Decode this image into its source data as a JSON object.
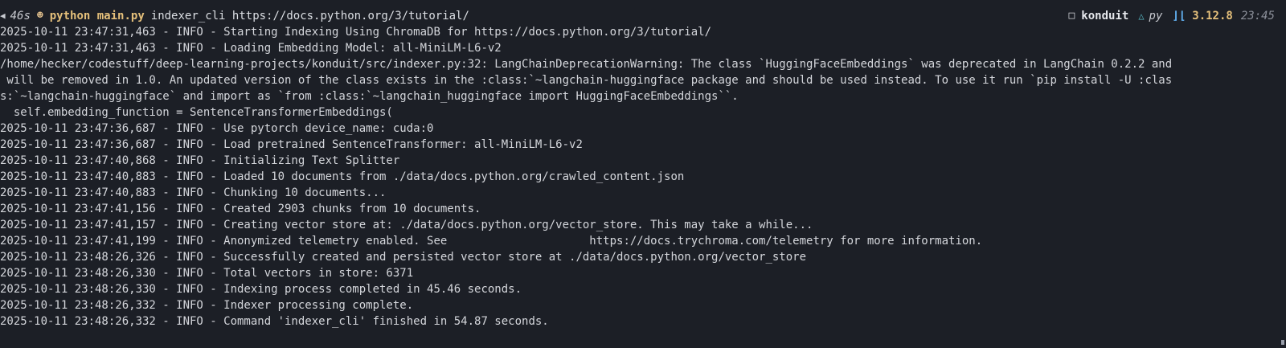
{
  "prompt": {
    "duration": "46s",
    "command_exe": "python main.py",
    "command_args": "indexer_cli https://docs.python.org/3/tutorial/",
    "directory": "konduit",
    "language": "py",
    "python_version": "3.12.8",
    "clock": "23:45"
  },
  "log_lines": [
    "2025-10-11 23:47:31,463 - INFO - Starting Indexing Using ChromaDB for https://docs.python.org/3/tutorial/",
    "2025-10-11 23:47:31,463 - INFO - Loading Embedding Model: all-MiniLM-L6-v2",
    "/home/hecker/codestuff/deep-learning-projects/konduit/src/indexer.py:32: LangChainDeprecationWarning: The class `HuggingFaceEmbeddings` was deprecated in LangChain 0.2.2 and",
    " will be removed in 1.0. An updated version of the class exists in the :class:`~langchain-huggingface package and should be used instead. To use it run `pip install -U :clas",
    "s:`~langchain-huggingface` and import as `from :class:`~langchain_huggingface import HuggingFaceEmbeddings``.",
    "  self.embedding_function = SentenceTransformerEmbeddings(",
    "2025-10-11 23:47:36,687 - INFO - Use pytorch device_name: cuda:0",
    "2025-10-11 23:47:36,687 - INFO - Load pretrained SentenceTransformer: all-MiniLM-L6-v2",
    "2025-10-11 23:47:40,868 - INFO - Initializing Text Splitter",
    "2025-10-11 23:47:40,883 - INFO - Loaded 10 documents from ./data/docs.python.org/crawled_content.json",
    "2025-10-11 23:47:40,883 - INFO - Chunking 10 documents...",
    "2025-10-11 23:47:41,156 - INFO - Created 2903 chunks from 10 documents.",
    "2025-10-11 23:47:41,157 - INFO - Creating vector store at: ./data/docs.python.org/vector_store. This may take a while...",
    "2025-10-11 23:47:41,199 - INFO - Anonymized telemetry enabled. See                     https://docs.trychroma.com/telemetry for more information.",
    "2025-10-11 23:48:26,326 - INFO - Successfully created and persisted vector store at ./data/docs.python.org/vector_store",
    "2025-10-11 23:48:26,330 - INFO - Total vectors in store: 6371",
    "2025-10-11 23:48:26,330 - INFO - Indexing process completed in 45.46 seconds.",
    "2025-10-11 23:48:26,332 - INFO - Indexer processing complete.",
    "2025-10-11 23:48:26,332 - INFO - Command 'indexer_cli' finished in 54.87 seconds."
  ],
  "icons": {
    "arrow": "triangle-left-icon",
    "status": "smiley-icon",
    "dir": "square-icon",
    "git": "delta-icon",
    "python": "python-icon"
  }
}
